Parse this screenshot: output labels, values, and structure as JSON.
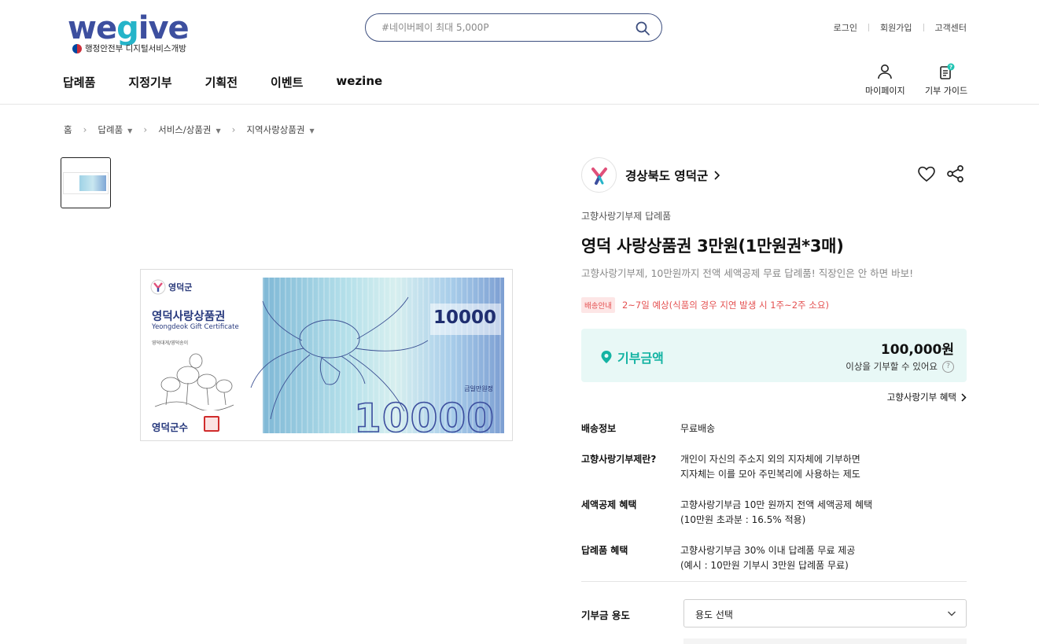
{
  "header": {
    "logo_text_a": "we",
    "logo_text_b": "g",
    "logo_text_c": "ive",
    "logo_sub": "행정안전부 디지털서비스개방",
    "search_placeholder": "#네이버페이 최대 5,000P",
    "util": [
      "로그인",
      "회원가입",
      "고객센터"
    ],
    "gnb": [
      "답례품",
      "지정기부",
      "기획전",
      "이벤트",
      "wezine"
    ],
    "mypage_label": "마이페이지",
    "guide_label": "기부 가이드"
  },
  "breadcrumb": {
    "home": "홈",
    "items": [
      "답례품",
      "서비스/상품권",
      "지역사랑상품권"
    ]
  },
  "voucher_image": {
    "brand": "영덕군",
    "title": "영덕사랑상품권",
    "subtitle": "Yeongdeok Gift Certificate",
    "small": "영덕대게/영덕송이",
    "sign": "영덕군수",
    "amount": "10000",
    "amount_label": "금일만원정"
  },
  "product": {
    "seller": "경상북도 영덕군",
    "category": "고향사랑기부제 답례품",
    "title": "영덕 사랑상품권 3만원(1만원권*3매)",
    "description": "고향사랑기부제, 10만원까지 전액 세액공제 무료 답례품! 직장인은 안 하면 바보!",
    "shipping_badge": "배송안내",
    "shipping_text": "2~7일 예상(식품의 경우 지연 발생 시 1주~2주 소요)"
  },
  "donation": {
    "label": "기부금액",
    "amount": "100,000원",
    "note": "이상을 기부할 수 있어요",
    "benefit_link": "고향사랑기부 혜택"
  },
  "info": [
    {
      "label": "배송정보",
      "lines": [
        "무료배송"
      ]
    },
    {
      "label": "고향사랑기부제란?",
      "lines": [
        "개인이 자신의 주소지 외의 지자체에 기부하면",
        "지자체는 이를 모아 주민복리에 사용하는 제도"
      ]
    },
    {
      "label": "세액공제 혜택",
      "lines": [
        "고향사랑기부금 10만 원까지 전액 세액공제 혜택",
        "(10만원 초과분 : 16.5% 적용)"
      ]
    },
    {
      "label": "답례품 혜택",
      "lines": [
        "고향사랑기부금 30% 이내 답례품 무료 제공",
        "(예시 : 10만원 기부시 3만원 답례품 무료)"
      ]
    }
  ],
  "usage": {
    "label": "기부금 용도",
    "selected": "용도 선택"
  },
  "colors": {
    "brand_navy": "#3d4f9f",
    "brand_teal": "#25b4c9",
    "donate_teal": "#14b3a3",
    "donate_bg": "#e8f8f6",
    "shipping_red": "#e45151"
  }
}
